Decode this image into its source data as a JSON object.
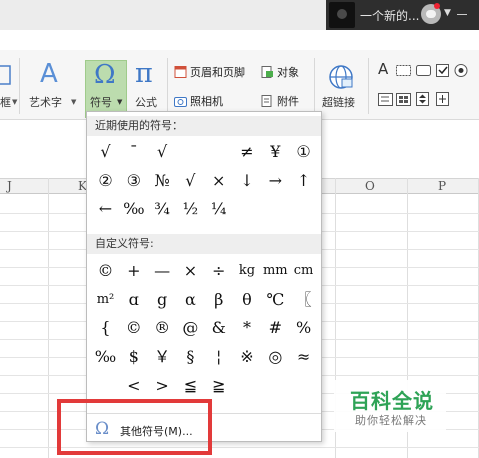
{
  "window": {
    "account_name": "一个新的...",
    "colors": {
      "titlebar": "#ececec",
      "account_bg": "#2e2e2e",
      "active_button": "#bcdcae",
      "highlight": "#e23a3a",
      "omega": "#6a8ec9"
    }
  },
  "toolbar": {
    "partial_label": "框",
    "wordart_label": "艺术字",
    "symbol_label": "符号",
    "formula_label": "公式",
    "header_footer_label": "页眉和页脚",
    "object_label": "对象",
    "camera_label": "照相机",
    "attachment_label": "附件",
    "hyperlink_label": "超链接",
    "icons": [
      "wordart-icon",
      "omega-icon",
      "pi-icon",
      "header-footer-icon",
      "object-icon",
      "camera-icon",
      "attachment-icon",
      "hyperlink-icon"
    ]
  },
  "sheet": {
    "columns": [
      "J",
      "K",
      "O",
      "P"
    ]
  },
  "symbol_menu": {
    "recent_title": "近期使用的符号：",
    "recent_symbols": [
      "√",
      "¯",
      "√",
      "",
      "",
      "≠",
      "¥",
      "①",
      "②",
      "③",
      "№",
      "√",
      "×",
      "↓",
      "→",
      "↑",
      "←",
      "‰",
      "¾",
      "½",
      "¼"
    ],
    "custom_title": "自定义符号:",
    "custom_symbols": [
      "©",
      "+",
      "—",
      "×",
      "÷",
      "kg",
      "mm",
      "cm",
      "m²",
      "ɑ",
      "g",
      "α",
      "β",
      "θ",
      "℃",
      "〖",
      "{",
      "©",
      "®",
      "@",
      "&",
      "*",
      "#",
      "%",
      "‰",
      "$",
      "￥",
      "§",
      "¦",
      "※",
      "◎",
      "≈",
      "",
      "<",
      ">",
      "≦",
      "≧"
    ],
    "more_label": "其他符号(M)..."
  },
  "watermark": {
    "title": "百科全说",
    "subtitle": "助你轻松解决"
  }
}
